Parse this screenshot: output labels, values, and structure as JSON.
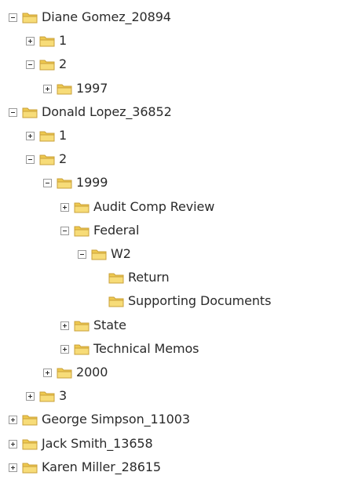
{
  "tree": {
    "nodes": [
      {
        "label": "Diane Gomez_20894",
        "toggle": "expanded",
        "depth": 0
      },
      {
        "label": "1",
        "toggle": "collapsed",
        "depth": 1
      },
      {
        "label": "2",
        "toggle": "expanded",
        "depth": 1
      },
      {
        "label": "1997",
        "toggle": "collapsed",
        "depth": 2
      },
      {
        "label": "Donald Lopez_36852",
        "toggle": "expanded",
        "depth": 0
      },
      {
        "label": "1",
        "toggle": "collapsed",
        "depth": 1
      },
      {
        "label": "2",
        "toggle": "expanded",
        "depth": 1
      },
      {
        "label": "1999",
        "toggle": "expanded",
        "depth": 2
      },
      {
        "label": "Audit Comp Review",
        "toggle": "collapsed",
        "depth": 3
      },
      {
        "label": "Federal",
        "toggle": "expanded",
        "depth": 3
      },
      {
        "label": "W2",
        "toggle": "expanded",
        "depth": 4
      },
      {
        "label": "Return",
        "toggle": "none",
        "depth": 5
      },
      {
        "label": "Supporting Documents",
        "toggle": "none",
        "depth": 5
      },
      {
        "label": "State",
        "toggle": "collapsed",
        "depth": 3
      },
      {
        "label": "Technical Memos",
        "toggle": "collapsed",
        "depth": 3
      },
      {
        "label": "2000",
        "toggle": "collapsed",
        "depth": 2
      },
      {
        "label": "3",
        "toggle": "collapsed",
        "depth": 1
      },
      {
        "label": "George Simpson_11003",
        "toggle": "collapsed",
        "depth": 0
      },
      {
        "label": "Jack Smith_13658",
        "toggle": "collapsed",
        "depth": 0
      },
      {
        "label": "Karen Miller_28615",
        "toggle": "collapsed",
        "depth": 0
      }
    ]
  },
  "colors": {
    "folder_fill": "#f7dc78",
    "folder_tab": "#eec94f",
    "folder_stroke": "#c9a03a",
    "text": "#2a2a2a",
    "toggle_border": "#9a9a9a"
  },
  "icons": {
    "folder": "folder-icon",
    "expanded": "minus-box-icon",
    "collapsed": "plus-box-icon"
  }
}
